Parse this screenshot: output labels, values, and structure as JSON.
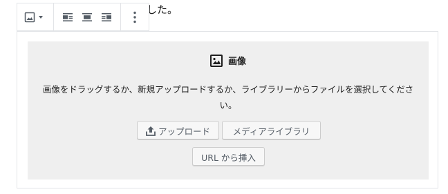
{
  "paragraph": {
    "text": "した。"
  },
  "toolbar": {
    "block_switcher_icon": "image-icon",
    "buttons": [
      "align-left-icon",
      "align-center-icon",
      "align-right-icon"
    ],
    "more_icon": "more-vertical-icon"
  },
  "placeholder": {
    "label": "画像",
    "instructions": "画像をドラッグするか、新規アップロードするか、ライブラリーからファイルを選択してください。",
    "upload_label": "アップロード",
    "media_library_label": "メディアライブラリ",
    "insert_url_label": "URL から挿入"
  },
  "colors": {
    "placeholder_bg": "#efefef",
    "border": "#e2e4e7",
    "button_text": "#555d66"
  }
}
